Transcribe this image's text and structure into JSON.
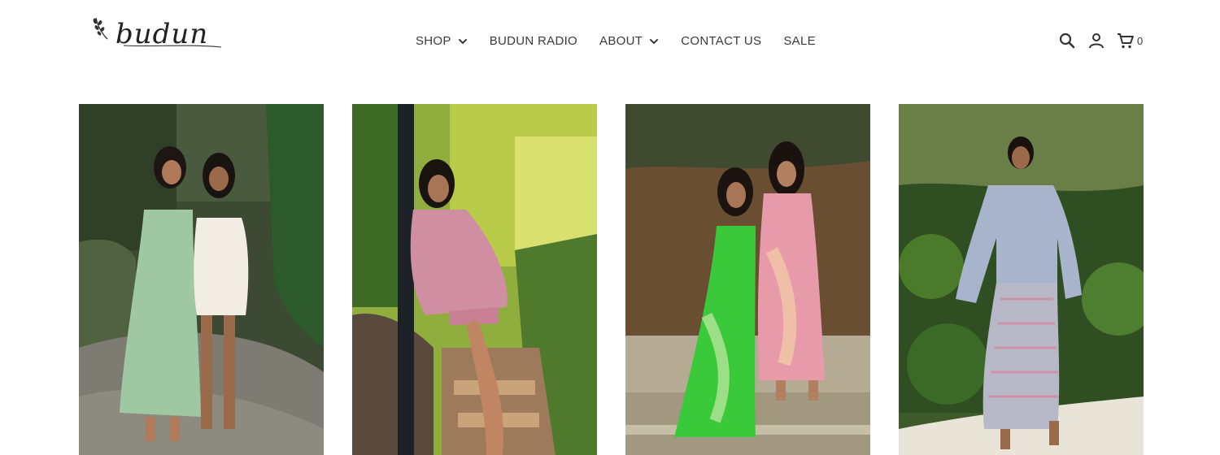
{
  "brand": {
    "logo_text": "budun"
  },
  "nav": {
    "items": [
      {
        "label": "SHOP",
        "has_dropdown": true
      },
      {
        "label": "BUDUN RADIO",
        "has_dropdown": false
      },
      {
        "label": "ABOUT",
        "has_dropdown": true
      },
      {
        "label": "CONTACT US",
        "has_dropdown": false
      },
      {
        "label": "SALE",
        "has_dropdown": false
      }
    ]
  },
  "header_icons": {
    "search": "search-icon",
    "account": "account-icon",
    "cart": "cart-icon",
    "cart_count": "0"
  },
  "gallery": {
    "images": [
      {
        "icon": "photo-two-women-garden-path"
      },
      {
        "icon": "photo-woman-pink-suit-lamppost"
      },
      {
        "icon": "photo-women-tie-dye-dresses"
      },
      {
        "icon": "photo-woman-striped-co-ord"
      }
    ]
  },
  "colors": {
    "text": "#3a3a3a",
    "background": "#ffffff"
  }
}
